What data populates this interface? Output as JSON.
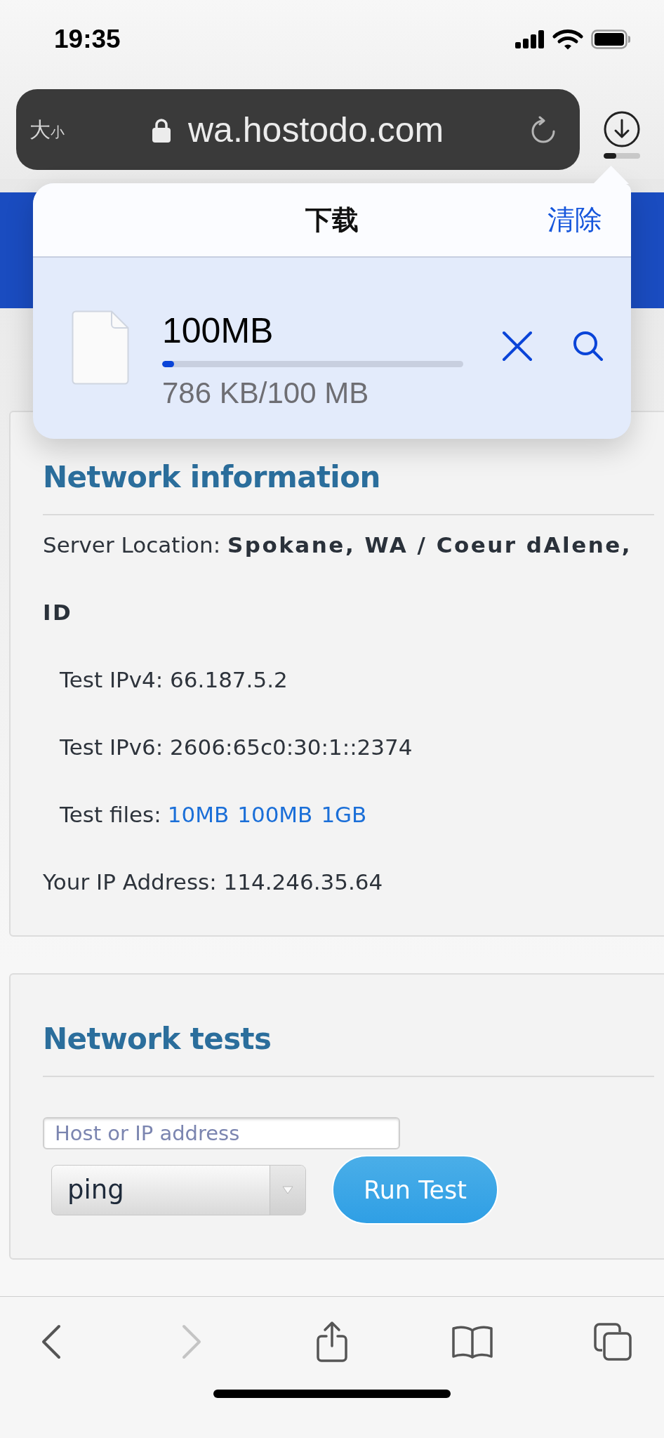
{
  "status_bar": {
    "time": "19:35"
  },
  "address_bar": {
    "text_size_button": "大$_{小}$",
    "url": "wa.hostodo.com",
    "download_button": {
      "level": 0.35
    }
  },
  "downloads_popup": {
    "title": "下载",
    "clear_button": "清除",
    "items": [
      {
        "name": "100MB",
        "level": 0.04,
        "progress_text": "786 KB/100 MB"
      }
    ]
  },
  "network_information": {
    "title": "Network information",
    "server_location": "Server Location: **Spokane, WA / Coeur dAlene, ID**",
    "test_ipv4": "Test IPv4: 66.187.5.2",
    "test_ipv6": "Test IPv6: 2606:65c0:30:1::2374",
    "test_files": {
      "label": "Test files:",
      "links": [
        "10MB",
        "100MB",
        "1GB"
      ]
    },
    "your_ip": "Your IP Address: 114.246.35.64"
  },
  "network_tests": {
    "title": "Network tests",
    "host_field": {
      "placeholder": "Host or IP address"
    },
    "test_select": {
      "value": "ping"
    },
    "run_button": "Run Test"
  },
  "toolbar": [
    {
      "kind": "back",
      "disabled": false
    },
    {
      "kind": "forward",
      "disabled": true
    },
    {
      "kind": "share",
      "disabled": false
    },
    {
      "kind": "bookmarks",
      "disabled": false
    },
    {
      "kind": "tabs",
      "disabled": false
    }
  ]
}
